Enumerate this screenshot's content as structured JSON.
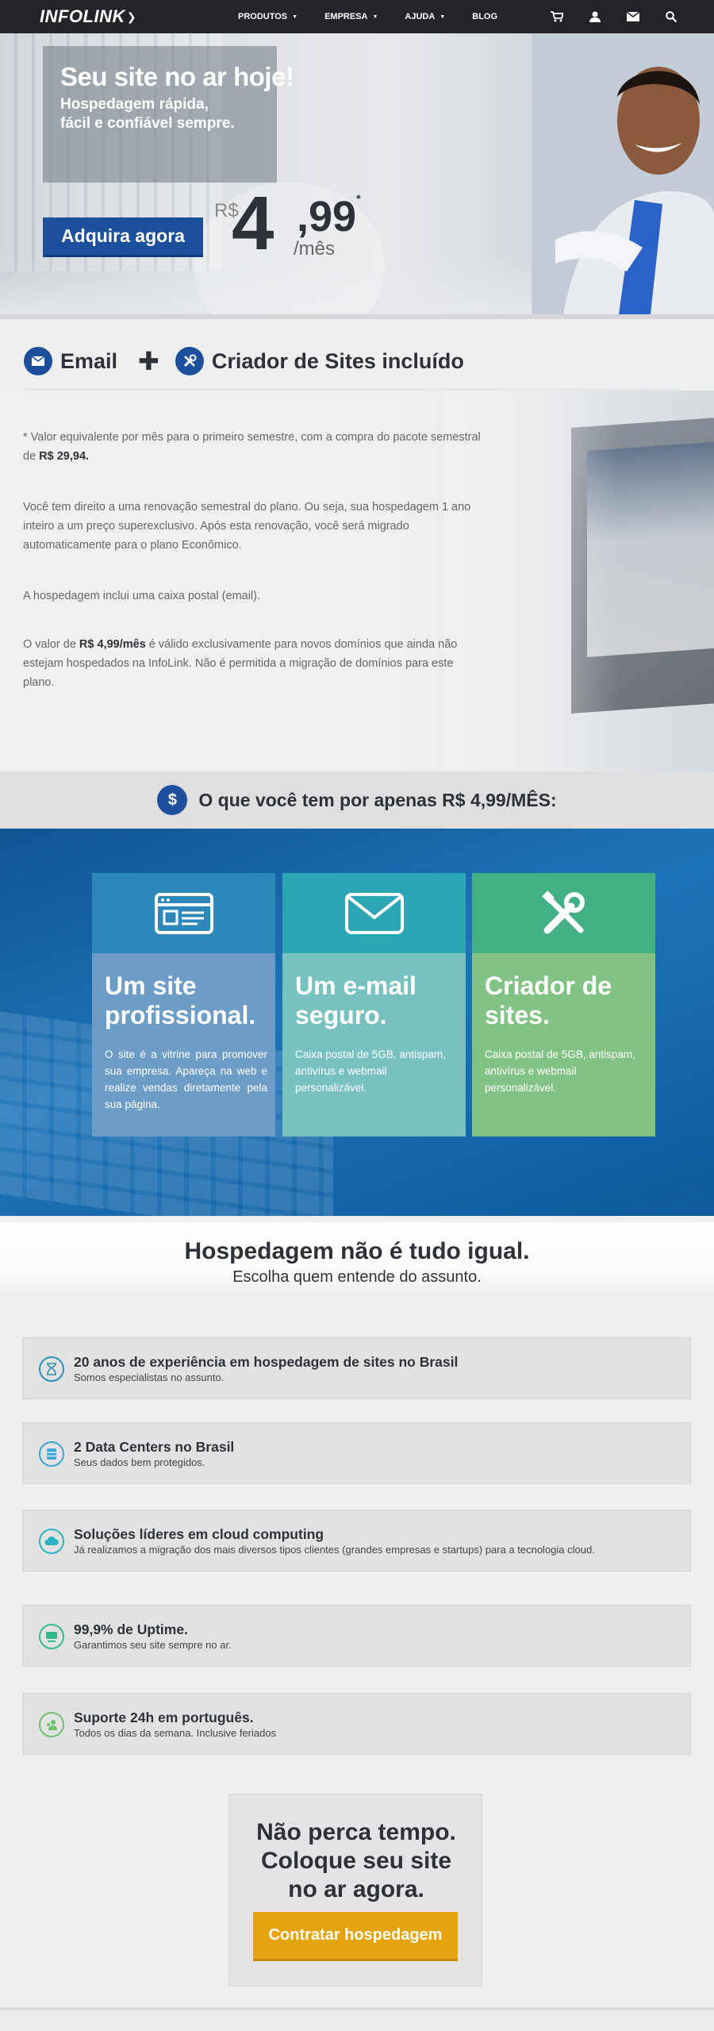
{
  "nav": {
    "logo": "INFOLINK",
    "menu": [
      {
        "label": "PRODUTOS",
        "has_caret": true
      },
      {
        "label": "EMPRESA",
        "has_caret": true
      },
      {
        "label": "AJUDA",
        "has_caret": true
      },
      {
        "label": "BLOG",
        "has_caret": false
      }
    ],
    "icons": [
      "cart-icon",
      "user-icon",
      "mail-icon",
      "search-icon"
    ]
  },
  "hero": {
    "title": "Seu site no ar hoje!",
    "subtitle": "Hospedagem rápida, fácil e confiável sempre.",
    "cta": "Adquira agora",
    "price_currency": "R$",
    "price_int": "4",
    "price_dec": ",99",
    "price_asterisk": "*",
    "price_per": "/mês"
  },
  "features": {
    "email_label": "Email",
    "plus": "✚",
    "builder_label": "Criador de Sites incluído"
  },
  "info": {
    "p1_a": "* Valor equivalente por mês para o primeiro semestre, com a compra do pacote semestral de ",
    "p1_b": "R$ 29,94.",
    "p2": "Você tem direito a uma renovação semestral do plano. Ou seja, sua hospedagem 1 ano inteiro a um preço superexclusivo. Após esta renovação, você será migrado automaticamente para o plano Econômico.",
    "p3": "A hospedagem inclui uma caixa postal (email).",
    "p4_a": "O valor de ",
    "p4_b": "R$ 4,99/mês",
    "p4_c": " é válido exclusivamente para novos domínios que ainda não estejam hospedados na InfoLink. Não é permitida a migração de domínios para este plano."
  },
  "whatbar": {
    "icon": "$",
    "text": "O que você tem por apenas R$ 4,99/MÊS:"
  },
  "cards": [
    {
      "title": "Um site profissional.",
      "text": "O site é a vitrine para promover sua empresa.   Apareça na web e realize vendas diretamente pela sua página.",
      "icon": "browser-icon",
      "top_color": "#2c88b8",
      "body_color": "#6d9dc6"
    },
    {
      "title": "Um e-mail seguro.",
      "text": "Caixa postal de 5GB, antispam, antivírus e webmail personalizável.",
      "icon": "envelope-icon",
      "top_color": "#2aa6b4",
      "body_color": "#78c1c1"
    },
    {
      "title": "Criador de sites.",
      "text": "Caixa postal de 5GB, antispam, antivírus e webmail personalizável.",
      "icon": "tools-icon",
      "top_color": "#43b084",
      "body_color": "#82c284"
    }
  ],
  "hosp": {
    "title": "Hospedagem não é tudo igual.",
    "subtitle": "Escolha quem entende do assunto."
  },
  "benefits": [
    {
      "title": "20 anos de experiência em hospedagem de sites no Brasil",
      "text": "Somos especialistas no assunto.",
      "icon": "hourglass-icon",
      "color": "#2d8fb8"
    },
    {
      "title": "2 Data Centers no Brasil",
      "text": "Seus dados bem protegidos.",
      "icon": "database-icon",
      "color": "#3aa6d6"
    },
    {
      "title": "Soluções líderes em cloud computing",
      "text": "Já realizamos a migração dos mais diversos tipos clientes  (grandes empresas e startups) para a tecnologia cloud.",
      "icon": "cloud-icon",
      "color": "#2ab3c0"
    },
    {
      "title": "99,9% de Uptime.",
      "text": "Garantimos seu site sempre no ar.",
      "icon": "server-icon",
      "color": "#32b98c"
    },
    {
      "title": "Suporte 24h em português.",
      "text": "Todos os dias da semana. Inclusive feriados",
      "icon": "support-icon",
      "color": "#6cc070"
    }
  ],
  "final": {
    "line1": "Não perca tempo.",
    "line2": "Coloque seu site",
    "line3": "no ar agora.",
    "cta": "Contratar hospedagem"
  }
}
